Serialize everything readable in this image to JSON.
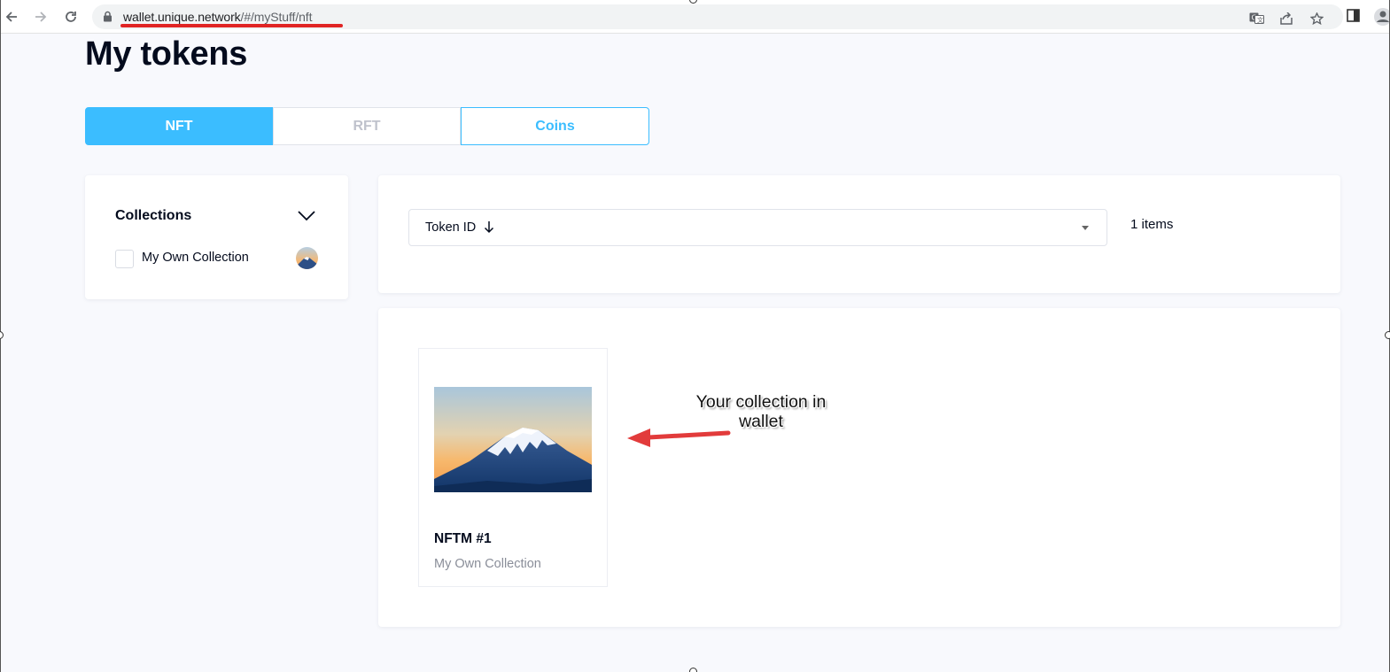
{
  "browser": {
    "url_host": "wallet.unique.network",
    "url_path": "/#/myStuff/nft",
    "icons": [
      "back-arrow-icon",
      "forward-arrow-icon",
      "reload-icon",
      "lock-icon",
      "translate-icon",
      "share-icon",
      "bookmark-star-icon",
      "side-panel-icon",
      "profile-icon"
    ]
  },
  "page": {
    "title": "My tokens"
  },
  "tabs": [
    {
      "label": "NFT",
      "state": "active"
    },
    {
      "label": "RFT",
      "state": "disabled"
    },
    {
      "label": "Coins",
      "state": "outlined"
    }
  ],
  "collections": {
    "title": "Collections",
    "items": [
      {
        "name": "My Own Collection",
        "checked": false
      }
    ]
  },
  "toolbar": {
    "sort_label": "Token ID",
    "sort_direction_icon": "arrow-down-icon",
    "items_count": "1 items"
  },
  "tokens": [
    {
      "name": "NFTM #1",
      "collection": "My Own Collection",
      "image": "mount-fuji-image"
    }
  ],
  "annotation": {
    "text": "Your collection in wallet",
    "color": "#e23b3b"
  },
  "colors": {
    "accent": "#3bbdff",
    "background": "#f8f9fd",
    "text": "#040b1d",
    "muted": "#8a8e99"
  }
}
